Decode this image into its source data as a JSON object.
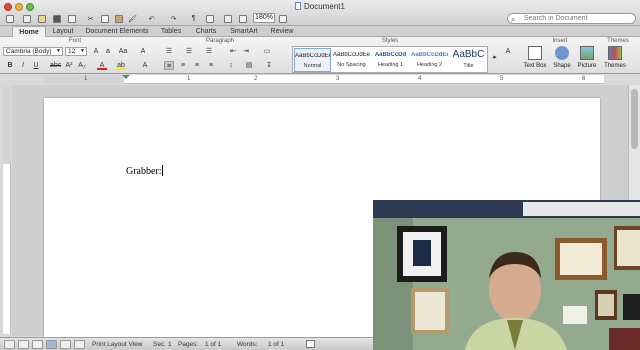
{
  "window": {
    "title": "Document1"
  },
  "toolbar": {
    "zoom": "180%",
    "search_placeholder": "Search in Document"
  },
  "tabs": [
    "Home",
    "Layout",
    "Document Elements",
    "Tables",
    "Charts",
    "SmartArt",
    "Review"
  ],
  "ribbon": {
    "groups": {
      "font": "Font",
      "paragraph": "Paragraph",
      "styles": "Styles",
      "insert": "Insert",
      "themes": "Themes"
    },
    "font_name": "Cambria (Body)",
    "font_size": "12",
    "styles": [
      {
        "sample": "AaBbCcDdEe",
        "name": "Normal"
      },
      {
        "sample": "AaBbCcDdEe",
        "name": "No Spacing"
      },
      {
        "sample": "AaBbCcDd",
        "name": "Heading 1"
      },
      {
        "sample": "AaBbCcDdEe",
        "name": "Heading 2"
      },
      {
        "sample": "AaBbC",
        "name": "Title"
      }
    ],
    "insert_buttons": [
      "Text Box",
      "Shape",
      "Picture"
    ],
    "themes_button": "Themes",
    "colors": {
      "font_color": "#d0231a",
      "highlight": "#f5e23a"
    }
  },
  "ruler": {
    "numbers": [
      "1",
      "1",
      "2",
      "3",
      "4",
      "5",
      "6"
    ]
  },
  "document": {
    "text": "Grabber:"
  },
  "status": {
    "view_name": "Print Layout View",
    "sec_label": "Sec",
    "sec_value": "1",
    "pages_label": "Pages:",
    "pages_value": "1 of 1",
    "words_label": "Words:",
    "words_value": "1 of 1"
  }
}
